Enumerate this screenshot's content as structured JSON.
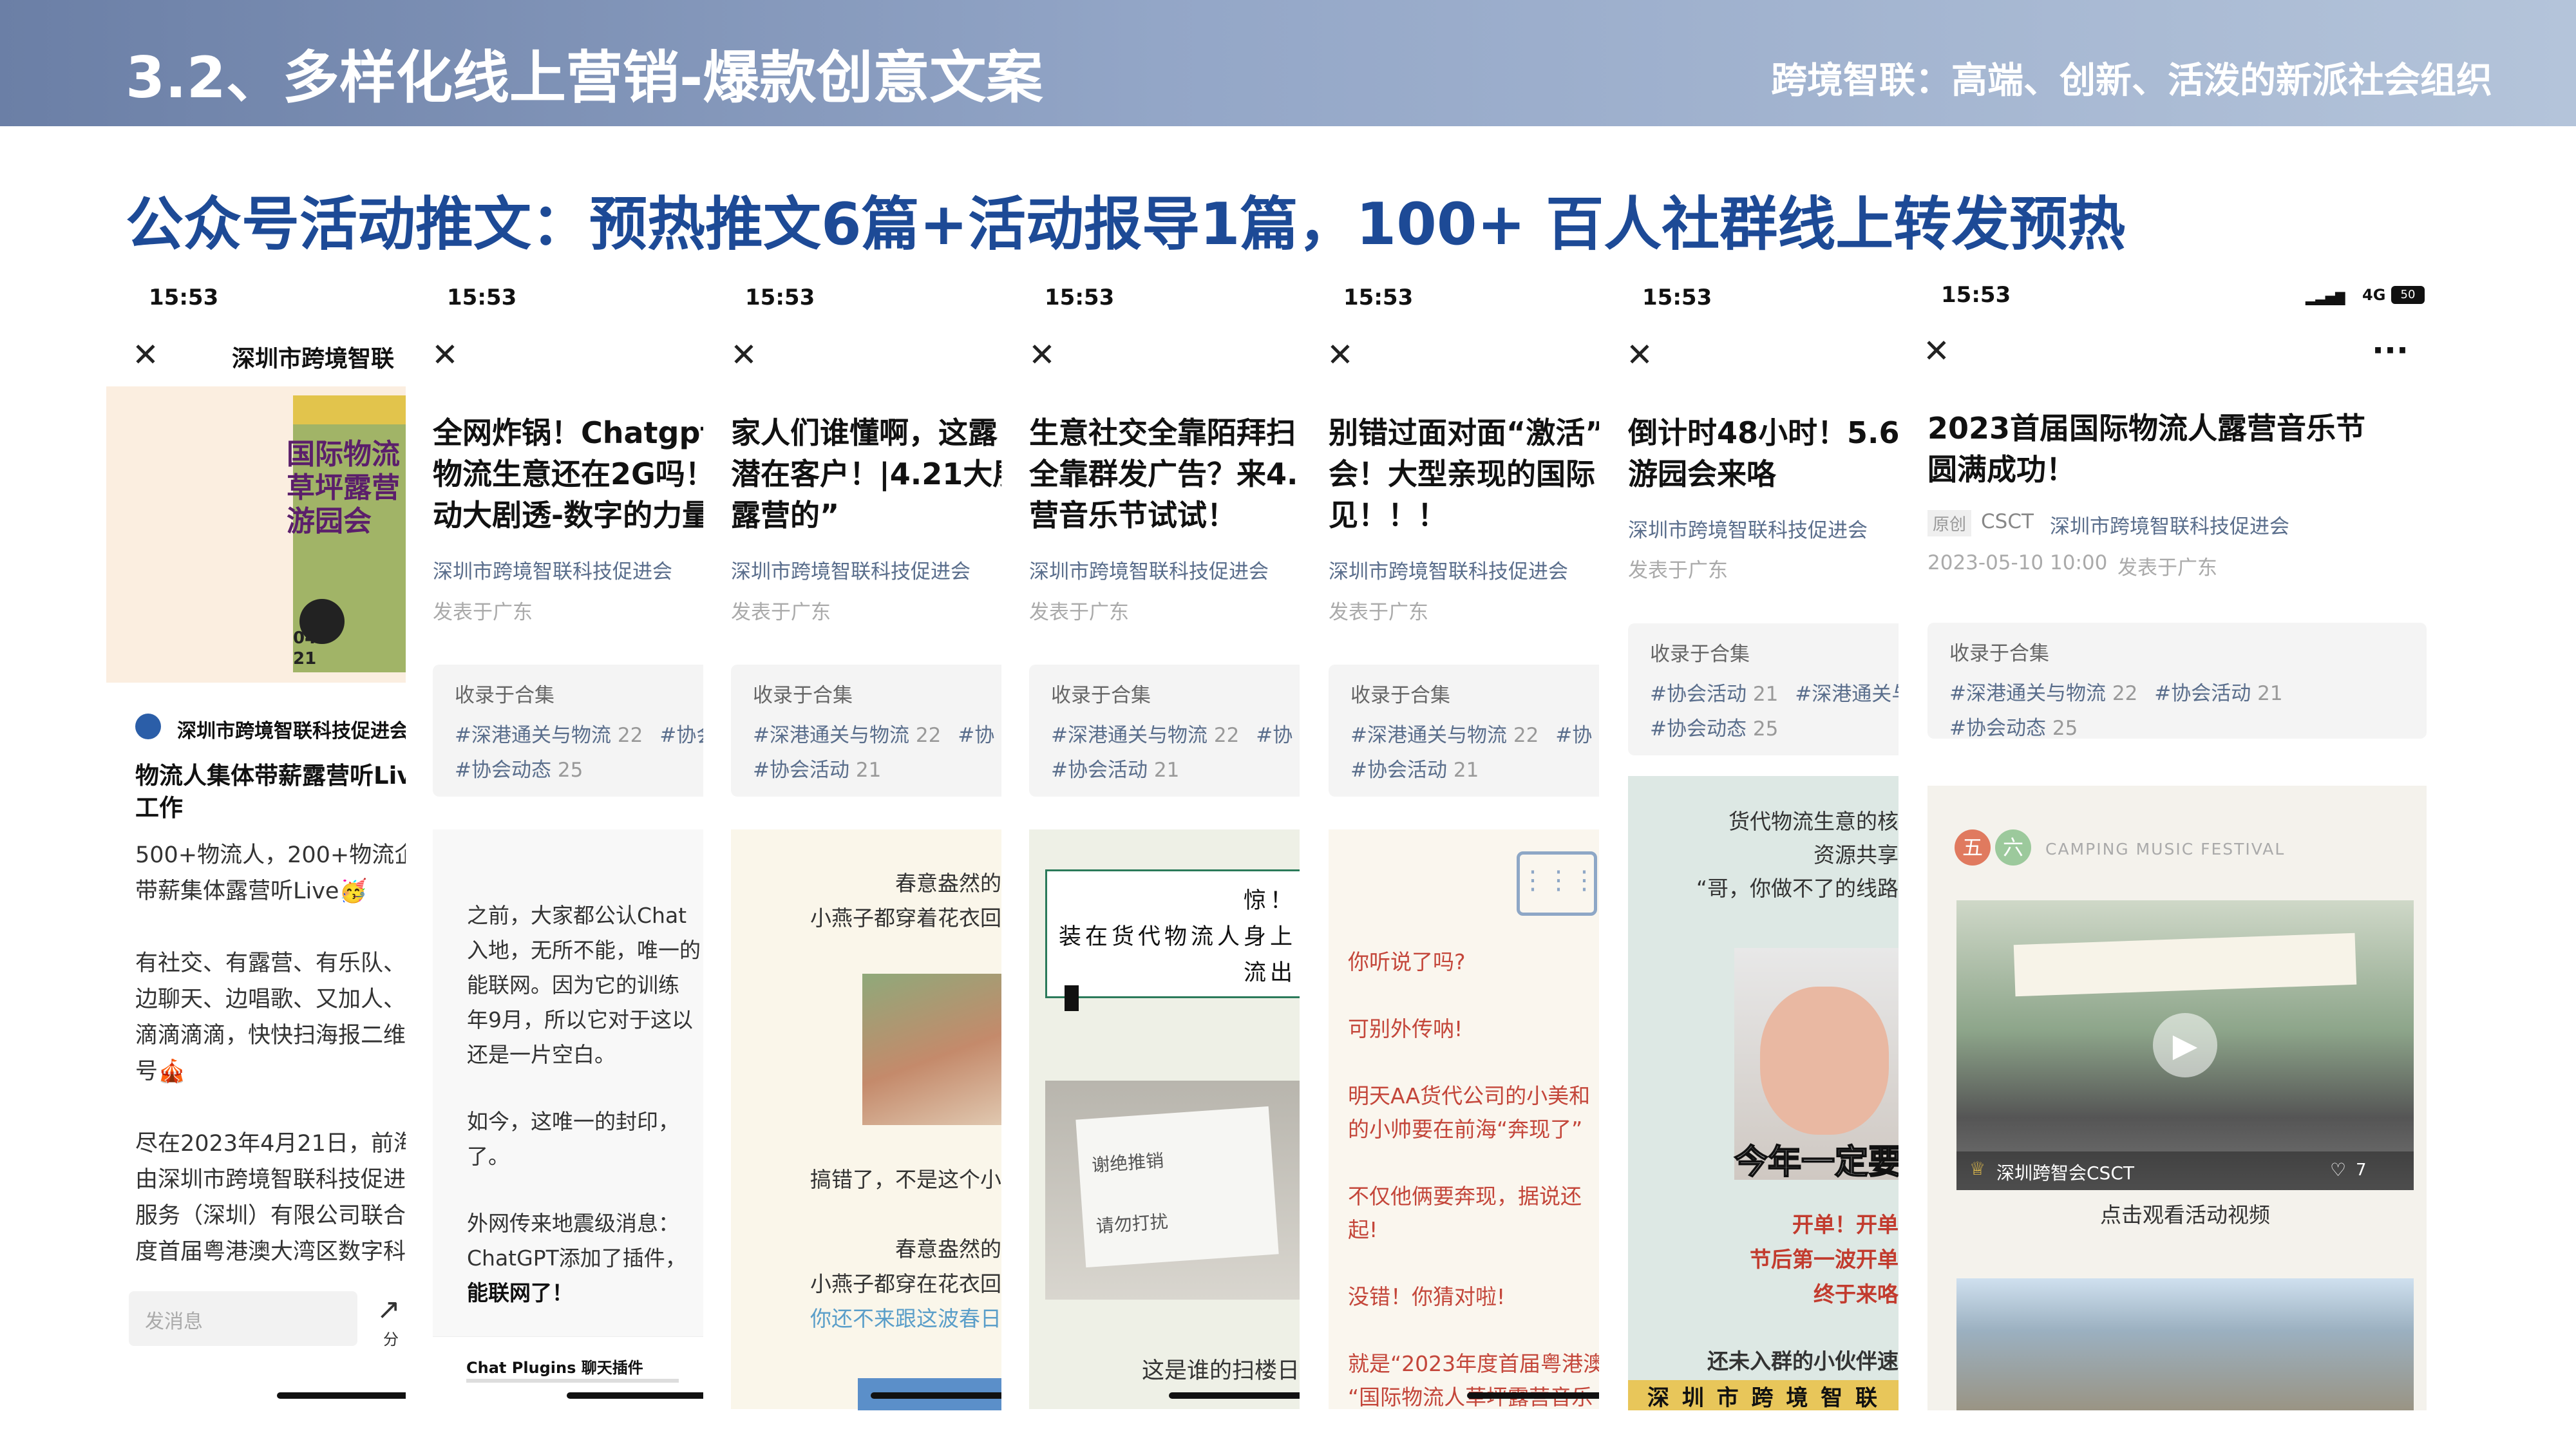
{
  "header": {
    "title": "3.2、多样化线上营销-爆款创意文案",
    "tagline": "跨境智联：高端、创新、活泼的新派社会组织"
  },
  "headline": "公众号活动推文：预热推文6篇+活动报导1篇，100+ 百人社群线上转发预热",
  "time": "15:53",
  "collection_heading": "收录于合集",
  "author": "深圳市跨境智联科技促进会",
  "location": "发表于广东",
  "phone1": {
    "account_title": "深圳市跨境智联",
    "poster_lines": [
      "国际物流",
      "草坪露营",
      "游园会"
    ],
    "poster_date": [
      "04",
      "21"
    ],
    "account_name": "深圳市跨境智联科技促进会",
    "post_title": [
      "物流人集体带薪露营听Live",
      "工作"
    ],
    "body": [
      "500+物流人，200+物流企",
      "带薪集体露营听Live🥳",
      "",
      "有社交、有露营、有乐队、",
      "边聊天、边唱歌、又加人、",
      "滴滴滴滴，快快扫海报二维",
      "号🎪",
      "",
      "尽在2023年4月21日，前海",
      "由深圳市跨境智联科技促进",
      "服务（深圳）有限公司联合",
      "度首届粤港澳大湾区数字科"
    ],
    "comment_placeholder": "发消息",
    "share_label": "分"
  },
  "phone2": {
    "title": [
      "全网炸锅！Chatgpt",
      "物流生意还在2G吗！",
      "动大剧透-数字的力量"
    ],
    "tags": [
      {
        "name": "#深港通关与物流",
        "count": "22"
      },
      {
        "name": "#协会",
        "count": ""
      },
      {
        "name": "#协会动态",
        "count": "25"
      }
    ],
    "body": [
      "之前，大家都公认Chat",
      "入地，无所不能，唯一的",
      "能联网。因为它的训练",
      "年9月，所以它对于这以",
      "还是一片空白。",
      "",
      "如今，这唯一的封印，",
      "了。",
      "",
      "外网传来地震级消息：",
      "ChatGPT添加了插件，",
      "能联网了！"
    ],
    "plugin_caption": "Chat Plugins 聊天插件"
  },
  "phone3": {
    "title": [
      "家人们谁懂啊，这露",
      "潜在客户！|4.21大展",
      "露营的”"
    ],
    "tags": [
      {
        "name": "#深港通关与物流",
        "count": "22"
      },
      {
        "name": "#协",
        "count": ""
      },
      {
        "name": "#协会活动",
        "count": "21"
      }
    ],
    "body": [
      "春意盎然的",
      "小燕子都穿着花衣回"
    ],
    "body2": [
      "搞错了，不是这个小",
      "",
      "春意盎然的",
      "小燕子都穿在花衣回"
    ],
    "link": "你还不来跟这波春日"
  },
  "phone4": {
    "title": [
      "生意社交全靠陌拜扫",
      "全靠群发广告？来4.",
      "营音乐节试试！"
    ],
    "tags": [
      {
        "name": "#深港通关与物流",
        "count": "22"
      },
      {
        "name": "#协",
        "count": ""
      },
      {
        "name": "#协会活动",
        "count": "21"
      }
    ],
    "board": [
      "惊！",
      "装在货代物流人身上",
      "流出"
    ],
    "sign": [
      "谢绝推销",
      "请勿打扰"
    ],
    "caption": "这是谁的扫楼日"
  },
  "phone5": {
    "title": [
      "别错过面对面“激活”",
      "会！大型亲现的国际",
      "见！！！"
    ],
    "tags": [
      {
        "name": "#深港通关与物流",
        "count": "22"
      },
      {
        "name": "#协",
        "count": ""
      },
      {
        "name": "#协会活动",
        "count": "21"
      }
    ],
    "body": [
      "你听说了吗?",
      "",
      "可别外传呐!",
      "",
      "明天AA货代公司的小美和",
      "的小帅要在前海“奔现了”",
      "",
      "不仅他俩要奔现，据说还",
      "起!",
      "",
      "没错！你猜对啦!",
      "",
      "就是“2023年度首届粤港澳",
      "“国际物流人草坪露营音乐"
    ]
  },
  "phone6": {
    "title": [
      "倒计时48小时！5.6",
      "游园会来咯"
    ],
    "tags": [
      {
        "name": "#协会活动",
        "count": "21"
      },
      {
        "name": "#深港通关与",
        "count": ""
      },
      {
        "name": "#协会动态",
        "count": "25"
      }
    ],
    "intro": [
      "货代物流生意的核",
      "资源共享",
      "“哥，你做不了的线路"
    ],
    "meme_caption": "今年一定要",
    "cta": [
      "开单！开单",
      "节后第一波开单",
      "终于来咯"
    ],
    "footer": [
      "还未入群的小伙伴速",
      "深 圳 市 跨 境 智 联"
    ]
  },
  "phone7": {
    "signal": "4G",
    "battery": "50",
    "more": "···",
    "title": [
      "2023首届国际物流人露营音乐节",
      "圆满成功！"
    ],
    "badge": "原创",
    "org": "CSCT",
    "author": "深圳市跨境智联科技促进会",
    "date": "2023-05-10 10:00",
    "loc": "发表于广东",
    "tags": [
      {
        "name": "#深港通关与物流",
        "count": "22"
      },
      {
        "name": "#协会活动",
        "count": "21"
      },
      {
        "name": "#协会动态",
        "count": "25"
      }
    ],
    "festival_chars": [
      "五",
      "六"
    ],
    "festival": "CAMPING MUSIC FESTIVAL",
    "video_account": "深圳跨智会CSCT",
    "video_likes": "7",
    "video_caption": "点击观看活动视频"
  },
  "colors": {
    "headline": "#1d4a96",
    "link": "#5a6e8c",
    "poster_bg": "#fbeee0",
    "poster_green": "#97ad5a"
  }
}
